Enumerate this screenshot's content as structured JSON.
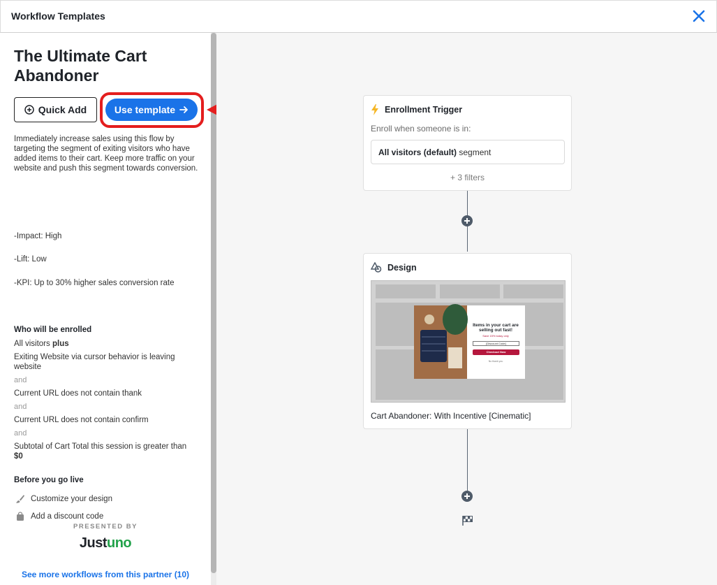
{
  "header": {
    "title": "Workflow Templates"
  },
  "template": {
    "title": "The Ultimate Cart Abandoner",
    "quick_add_label": "Quick Add",
    "use_template_label": "Use template",
    "description": "Immediately increase sales using this flow by targeting the segment of exiting visitors who have added items to their cart. Keep more traffic on your website and push this segment towards conversion.",
    "impact": "-Impact: High",
    "lift": "-Lift: Low",
    "kpi": "-KPI: Up to 30% higher sales conversion rate"
  },
  "enrollment": {
    "heading": "Who will be enrolled",
    "visitors_prefix": "All visitors",
    "visitors_bold": "plus",
    "conditions": [
      "Exiting Website via cursor behavior is leaving website",
      "Current URL does not contain thank",
      "Current URL does not contain confirm"
    ],
    "and_label": "and",
    "subtotal_text": "Subtotal of Cart Total this session is greater than",
    "subtotal_value": "$0"
  },
  "before_live": {
    "heading": "Before you go live",
    "items": [
      "Customize your design",
      "Add a discount code"
    ]
  },
  "partner": {
    "presented_by": "PRESENTED BY",
    "logo_part1": "Just",
    "logo_part2": "uno",
    "more_link": "See more workflows from this partner (10)"
  },
  "workflow": {
    "trigger": {
      "title": "Enrollment Trigger",
      "subtitle": "Enroll when someone is in:",
      "segment_bold": "All visitors (default)",
      "segment_suffix": "segment",
      "filters": "+ 3 filters"
    },
    "design": {
      "title": "Design",
      "caption": "Cart Abandoner: With Incentive [Cinematic]",
      "popup_headline": "Items in your cart are selling out fast!",
      "popup_sub": "Save 15% today only",
      "popup_field": "[Discount Code]",
      "popup_button": "Checkout Now",
      "popup_dismiss": "No thank you"
    }
  },
  "colors": {
    "primary": "#1a73e8",
    "highlight": "#e41e1e",
    "brand_green": "#22a24a",
    "popup_red": "#b5173d"
  }
}
